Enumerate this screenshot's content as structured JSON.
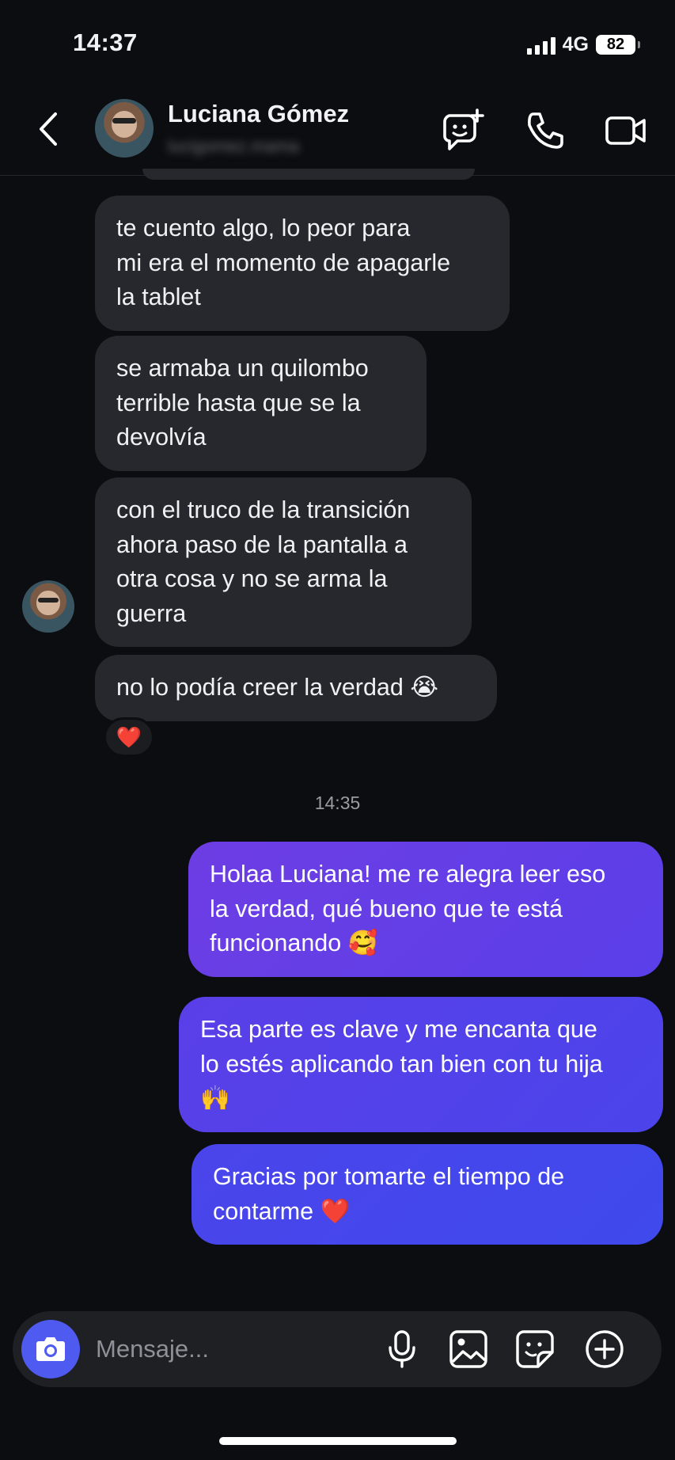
{
  "status_bar": {
    "time": "14:37",
    "network": "4G",
    "battery": "82"
  },
  "header": {
    "contact_name": "Luciana Gómez",
    "contact_username": "lucigomez.mama"
  },
  "messages": {
    "incoming": [
      "te cuento algo, lo peor para\nmi era el momento de apagarle\nla tablet",
      "se armaba un quilombo\nterrible hasta que se la\ndevolvía",
      "con el truco de la transición\nahora paso de la pantalla  a\notra cosa y no se arma la\nguerra",
      "no lo podía creer la verdad 😭"
    ],
    "reaction": "❤️",
    "time_divider": "14:35",
    "outgoing": [
      "Holaa Luciana! me re alegra leer eso\nla verdad, qué bueno que te está\nfuncionando 🥰",
      "Esa parte es clave y me encanta que\nlo estés aplicando tan bien con tu hija\n🙌",
      "Gracias por tomarte el tiempo de\ncontarme ❤️"
    ]
  },
  "composer": {
    "placeholder": "Mensaje..."
  },
  "colors": {
    "background": "#0c0d10",
    "incoming_bubble": "#26282e",
    "outgoing_gradient": [
      "#6a3ee6",
      "#4c43ea",
      "#3f49ec"
    ],
    "camera_button": "#4f5af0"
  },
  "icons": {
    "back": "chevron-left-icon",
    "new_chat": "chat-plus-icon",
    "call": "phone-icon",
    "video": "video-camera-icon",
    "camera": "camera-icon",
    "mic": "microphone-icon",
    "gallery": "image-icon",
    "sticker": "sticker-icon",
    "more": "plus-circle-icon"
  }
}
